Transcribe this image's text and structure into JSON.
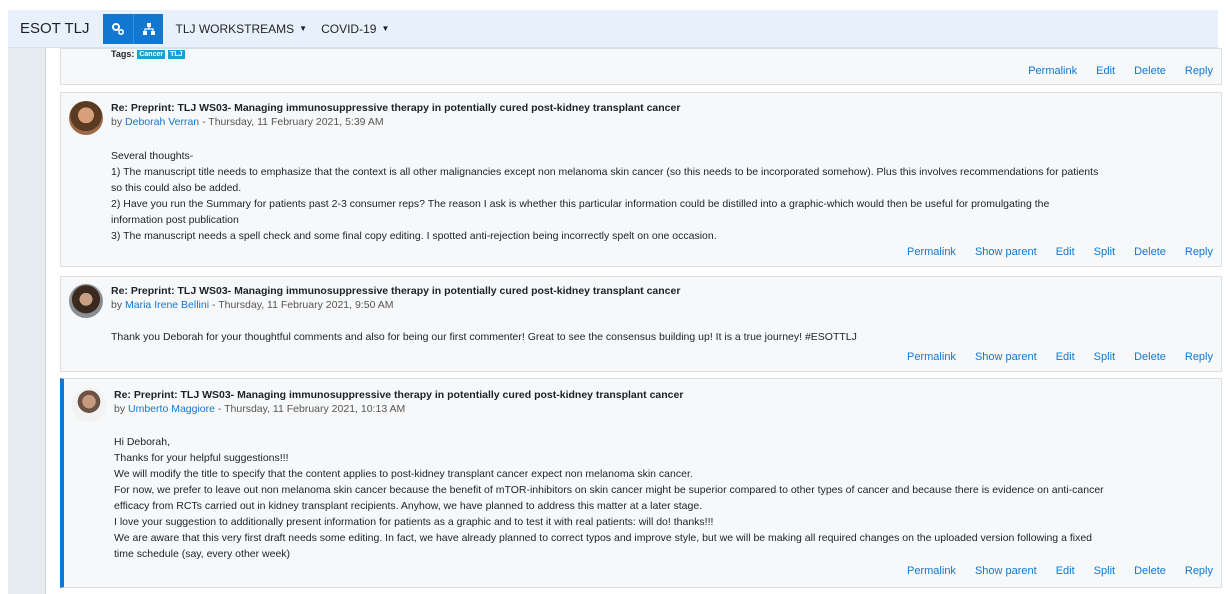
{
  "navbar": {
    "brand": "ESOT TLJ",
    "menu": [
      {
        "label": "TLJ WORKSTREAMS"
      },
      {
        "label": "COVID-19"
      }
    ]
  },
  "first_post": {
    "tags_label": "Tags:",
    "tags": [
      "Cancer",
      "TLJ"
    ],
    "actions": [
      "Permalink",
      "Edit",
      "Delete",
      "Reply"
    ]
  },
  "posts": [
    {
      "subject": "Re: Preprint: TLJ WS03- Managing immunosuppressive therapy in potentially cured post-kidney transplant cancer",
      "by": "by ",
      "author": "Deborah Verran",
      "date": " - Thursday, 11 February 2021, 5:39 AM",
      "lines": [
        "Several thoughts-",
        "1) The manuscript title needs to emphasize that the context is all other malignancies except non melanoma skin cancer (so this needs to be incorporated somehow). Plus this involves recommendations for patients",
        "so this could also be added.",
        "2) Have you run the Summary for patients past 2-3 consumer reps? The reason I ask is whether this particular information could be distilled into a graphic-which would then be useful for promulgating the",
        "information post publication",
        "3) The manuscript needs a spell check and some final copy editing. I spotted anti-rejection being incorrectly spelt on one occasion."
      ],
      "actions": [
        "Permalink",
        "Show parent",
        "Edit",
        "Split",
        "Delete",
        "Reply"
      ]
    },
    {
      "subject": "Re: Preprint: TLJ WS03- Managing immunosuppressive therapy in potentially cured post-kidney transplant cancer",
      "by": "by ",
      "author": "Maria Irene Bellini",
      "date": " - Thursday, 11 February 2021, 9:50 AM",
      "lines": [
        "Thank you Deborah for your thoughtful comments and also for being our first commenter! Great to see the consensus building up! It is a true journey! #ESOTTLJ"
      ],
      "actions": [
        "Permalink",
        "Show parent",
        "Edit",
        "Split",
        "Delete",
        "Reply"
      ]
    },
    {
      "subject": "Re: Preprint: TLJ WS03- Managing immunosuppressive therapy in potentially cured post-kidney transplant cancer",
      "by": "by ",
      "author": "Umberto Maggiore",
      "date": " - Thursday, 11 February 2021, 10:13 AM",
      "lines": [
        "Hi Deborah,",
        "Thanks for your helpful suggestions!!!",
        "We will modify the title to specify that the content applies to post-kidney transplant cancer expect non melanoma skin cancer.",
        "For now, we prefer to leave out non melanoma skin cancer because the benefit of mTOR-inhibitors on skin cancer might be superior compared to other types of cancer and because there is evidence on anti-cancer",
        "efficacy from RCTs carried out in kidney transplant recipients. Anyhow, we have planned to address this matter at a later stage.",
        "I love your suggestion to additionally present information for patients as a graphic and to test it with real patients: will do! thanks!!!",
        "We are aware that this very first draft needs some editing. In fact, we have already planned to correct typos and improve style, but we will be making all required changes on the uploaded version following a fixed",
        "time schedule (say, every other week)"
      ],
      "actions": [
        "Permalink",
        "Show parent",
        "Edit",
        "Split",
        "Delete",
        "Reply"
      ]
    }
  ]
}
